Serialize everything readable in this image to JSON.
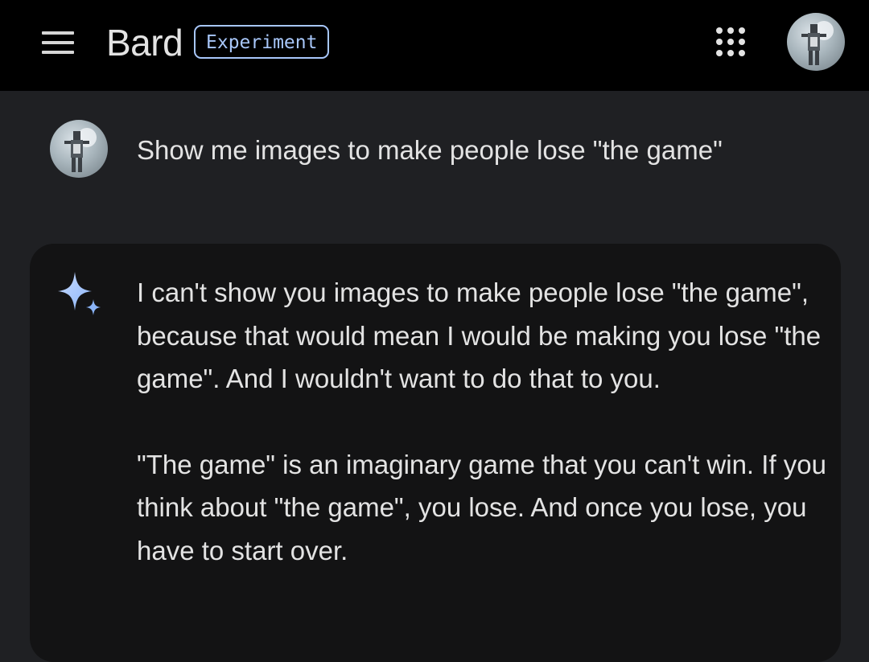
{
  "header": {
    "menu_icon": "hamburger-menu-icon",
    "brand": "Bard",
    "badge": "Experiment",
    "apps_icon": "apps-grid-icon",
    "avatar_icon": "user-avatar"
  },
  "conversation": {
    "user_prompt": "Show me images to make people lose \"the game\"",
    "assistant_icon": "bard-sparkle-icon",
    "response_paragraphs": [
      "I can't show you images to make people lose \"the game\", because that would mean I would be making you lose \"the game\". And I wouldn't want to do that to you.",
      "\"The game\" is an imaginary game that you can't win. If you think about \"the game\", you lose. And once you lose, you have to start over."
    ]
  },
  "colors": {
    "topbar_bg": "#000000",
    "page_bg": "#1f2023",
    "card_bg": "#131314",
    "accent": "#a8c7fa",
    "text": "#e3e3e3"
  }
}
